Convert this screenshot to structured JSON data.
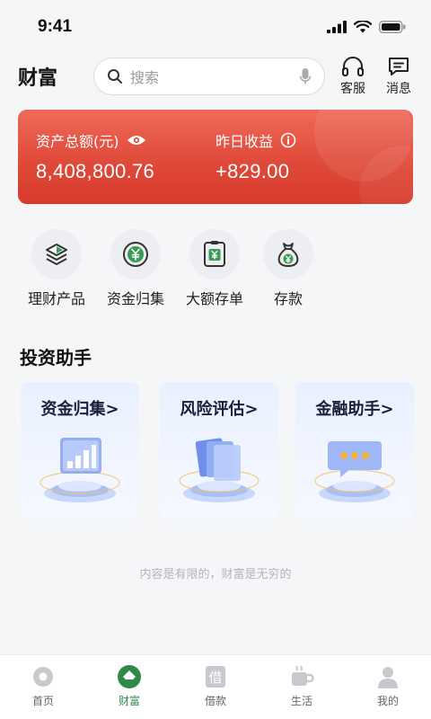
{
  "status_bar": {
    "time": "9:41"
  },
  "header": {
    "title": "财富",
    "search_placeholder": "搜索",
    "service_label": "客服",
    "message_label": "消息"
  },
  "asset_card": {
    "total_label": "资产总额(元)",
    "total_value": "8,408,800.76",
    "yesterday_label": "昨日收益",
    "yesterday_value": "+829.00",
    "color_top": "#ef6a5a",
    "color_bottom": "#d63a2b"
  },
  "quick_entries": [
    {
      "label": "理财产品",
      "icon": "layers-icon"
    },
    {
      "label": "资金归集",
      "icon": "yuan-coin-icon"
    },
    {
      "label": "大额存单",
      "icon": "certificate-icon"
    },
    {
      "label": "存款",
      "icon": "money-bag-icon"
    }
  ],
  "assistant": {
    "title": "投资助手",
    "cards": [
      {
        "title": "资金归集>",
        "icon": "bar-chart-icon"
      },
      {
        "title": "风险评估>",
        "icon": "documents-icon"
      },
      {
        "title": "金融助手>",
        "icon": "chat-bubble-icon"
      }
    ]
  },
  "slogan": "内容是有限的，财富是无穷的",
  "tabs": [
    {
      "label": "首页",
      "icon": "home-icon",
      "active": false
    },
    {
      "label": "财富",
      "icon": "wealth-icon",
      "active": true
    },
    {
      "label": "借款",
      "icon": "loan-icon",
      "active": false
    },
    {
      "label": "生活",
      "icon": "coffee-icon",
      "active": false
    },
    {
      "label": "我的",
      "icon": "profile-icon",
      "active": false
    }
  ],
  "colors": {
    "accent_green": "#2f8a4a",
    "assist_blue": "#4a7bf5"
  }
}
